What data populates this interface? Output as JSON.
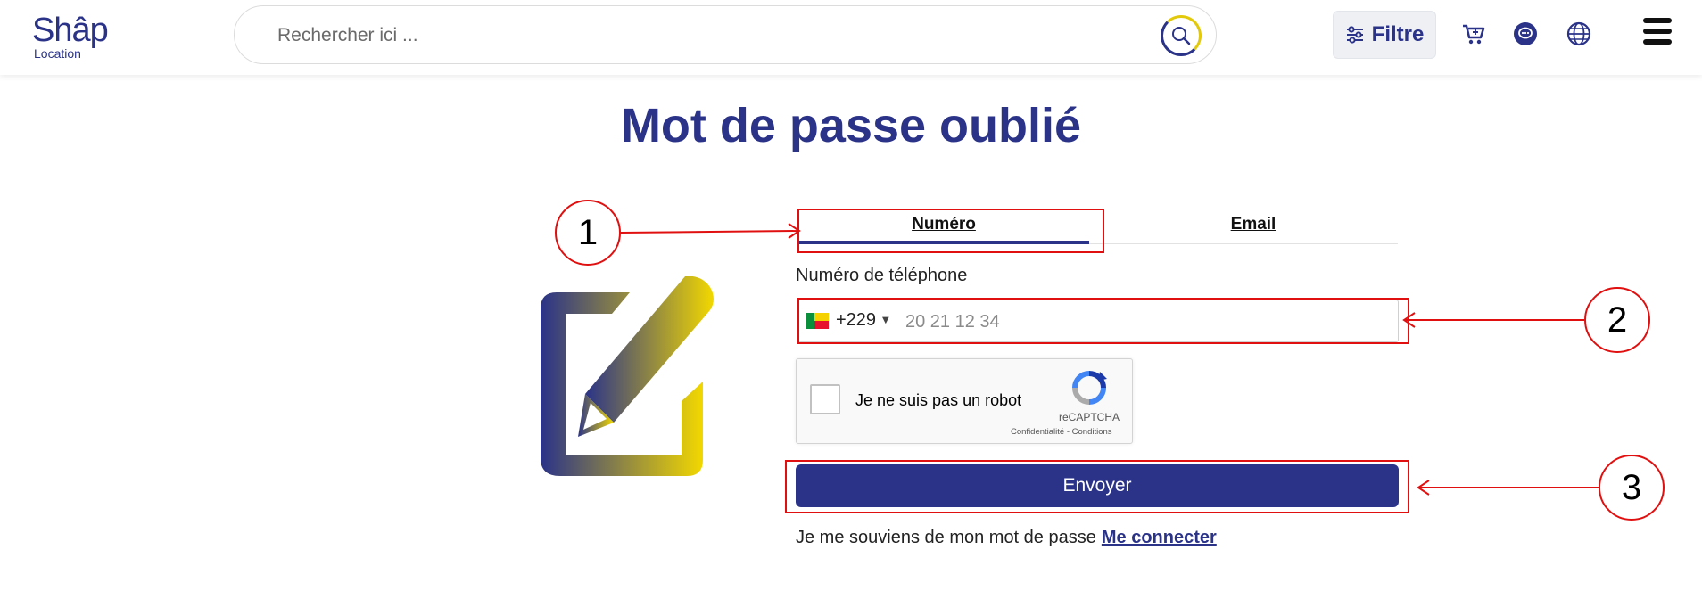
{
  "header": {
    "logo_main": "Shâp",
    "logo_sub": "Location",
    "search_placeholder": "Rechercher ici ...",
    "filter_label": "Filtre",
    "icons": [
      "search-icon",
      "sliders-icon",
      "cart-icon",
      "chat-icon",
      "globe-icon",
      "menu-icon"
    ]
  },
  "page": {
    "title": "Mot de passe oublié"
  },
  "tabs": [
    {
      "label": "Numéro",
      "active": true
    },
    {
      "label": "Email",
      "active": false
    }
  ],
  "form": {
    "phone_label": "Numéro de téléphone",
    "country_code": "+229",
    "phone_placeholder": "20 21 12 34",
    "captcha_text": "Je ne suis pas un robot",
    "captcha_brand": "reCAPTCHA",
    "captcha_links": "Confidentialité - Conditions",
    "submit_label": "Envoyer",
    "remember_text": "Je me souviens de mon mot de passe",
    "login_link": "Me connecter"
  },
  "annotations": [
    {
      "number": "1"
    },
    {
      "number": "2"
    },
    {
      "number": "3"
    }
  ],
  "colors": {
    "brand": "#2a3388",
    "accent": "#e3c90c",
    "annotation": "#e01010"
  }
}
